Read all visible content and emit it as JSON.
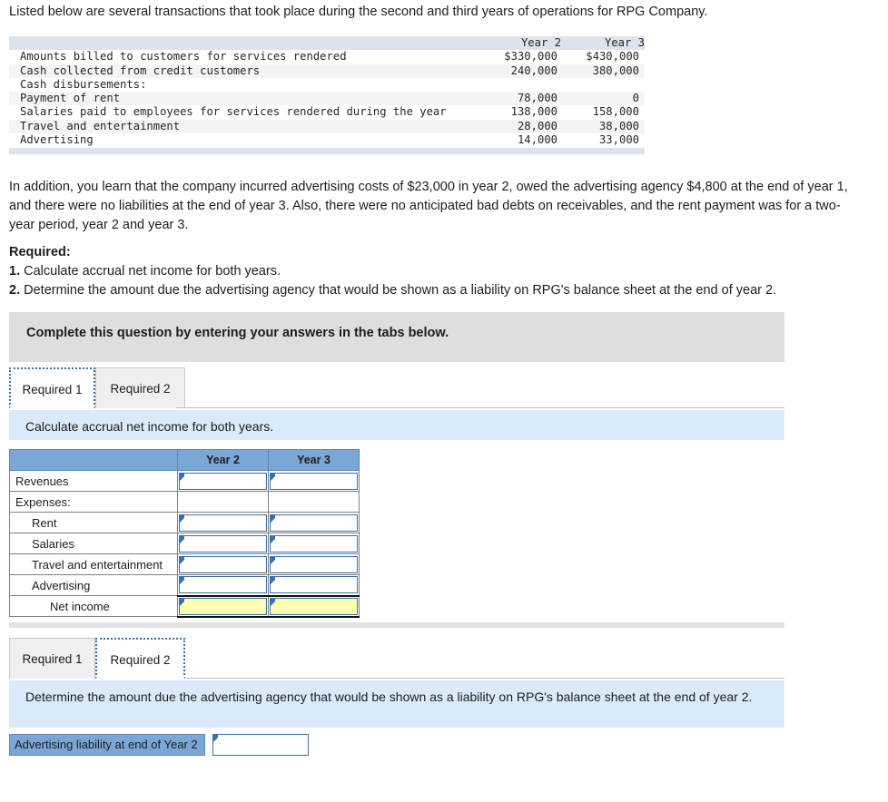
{
  "intro": {
    "text": "Listed below are several transactions that took place during the second and third years of operations for RPG Company."
  },
  "source_table": {
    "headers": {
      "label": "",
      "year2": "Year 2",
      "year3": "Year 3"
    },
    "rows": [
      {
        "label": "Amounts billed to customers for services rendered",
        "year2": "$330,000",
        "year3": "$430,000"
      },
      {
        "label": "Cash collected from credit customers",
        "year2": "240,000",
        "year3": "380,000"
      },
      {
        "label": "Cash disbursements:",
        "year2": "",
        "year3": ""
      },
      {
        "label": "Payment of rent",
        "year2": "78,000",
        "year3": "0"
      },
      {
        "label": "Salaries paid to employees for services rendered during the year",
        "year2": "138,000",
        "year3": "158,000"
      },
      {
        "label": "Travel and entertainment",
        "year2": "28,000",
        "year3": "38,000"
      },
      {
        "label": "Advertising",
        "year2": "14,000",
        "year3": "33,000"
      }
    ]
  },
  "body_paragraph": {
    "text": "In addition, you learn that the company incurred advertising costs of $23,000 in year 2, owed the advertising agency $4,800 at the end of year 1, and there were no liabilities at the end of year 3. Also, there were no anticipated bad debts on receivables, and the rent payment was for a two-year period, year 2 and year 3."
  },
  "required": {
    "heading": "Required:",
    "items": [
      {
        "num": "1.",
        "text": "Calculate accrual net income for both years."
      },
      {
        "num": "2.",
        "text": "Determine the amount due the advertising agency that would be shown as a liability on RPG's balance sheet at the end of year 2."
      }
    ]
  },
  "callout": {
    "text": "Complete this question by entering your answers in the tabs below."
  },
  "section1": {
    "tabs": [
      {
        "label": "Required 1",
        "active": true
      },
      {
        "label": "Required 2",
        "active": false
      }
    ],
    "instruction": "Calculate accrual net income for both years.",
    "grid": {
      "headers": [
        "",
        "Year 2",
        "Year 3"
      ],
      "rows": [
        {
          "label": "Revenues",
          "indent": 0,
          "inputs": true,
          "highlight": false
        },
        {
          "label": "Expenses:",
          "indent": 0,
          "inputs": false,
          "highlight": false
        },
        {
          "label": "Rent",
          "indent": 1,
          "inputs": true,
          "highlight": false
        },
        {
          "label": "Salaries",
          "indent": 1,
          "inputs": true,
          "highlight": false
        },
        {
          "label": "Travel and entertainment",
          "indent": 1,
          "inputs": true,
          "highlight": false
        },
        {
          "label": "Advertising",
          "indent": 1,
          "inputs": true,
          "highlight": false
        },
        {
          "label": "Net income",
          "indent": 2,
          "inputs": true,
          "highlight": true
        }
      ],
      "values": {
        "Revenues": {
          "year2": "",
          "year3": ""
        },
        "Rent": {
          "year2": "",
          "year3": ""
        },
        "Salaries": {
          "year2": "",
          "year3": ""
        },
        "Travel and entertainment": {
          "year2": "",
          "year3": ""
        },
        "Advertising": {
          "year2": "",
          "year3": ""
        },
        "Net income": {
          "year2": "",
          "year3": ""
        }
      }
    }
  },
  "section2": {
    "tabs": [
      {
        "label": "Required 1",
        "active": false
      },
      {
        "label": "Required 2",
        "active": true
      }
    ],
    "instruction": "Determine the amount due the advertising agency that would be shown as a liability on RPG's balance sheet at the end of year 2.",
    "answer_row": {
      "label": "Advertising liability at end of Year 2",
      "value": ""
    }
  },
  "colors": {
    "header_blue": "#7ba7d7",
    "instruction_blue": "#daeafa",
    "callout_gray": "#dedede",
    "table_header_gray": "#dde3ec",
    "highlight_yellow": "#feffb0",
    "input_border_blue": "#3d6fa5"
  }
}
